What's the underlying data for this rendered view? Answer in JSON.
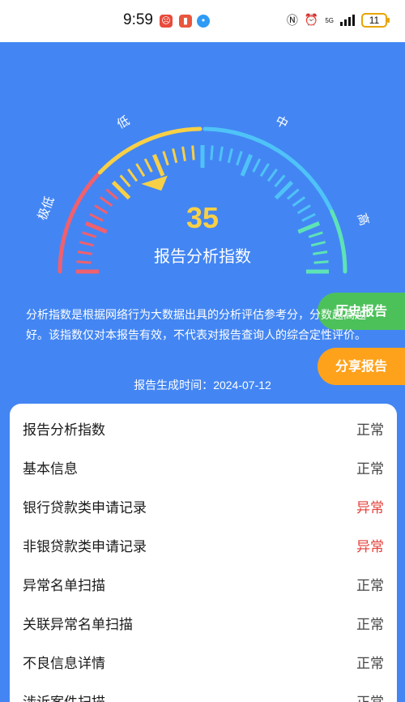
{
  "status_bar": {
    "time": "9:59",
    "network_label": "5G",
    "battery": "11"
  },
  "gauge": {
    "labels": {
      "very_low": "极低",
      "low": "低",
      "mid": "中",
      "high": "高"
    },
    "score": "35",
    "title": "报告分析指数",
    "colors": {
      "red": "#F0606E",
      "yellow": "#F7D046",
      "cyan": "#4FC3F7",
      "green": "#5EE3B5"
    }
  },
  "description": "分析指数是根据网络行为大数据出具的分析评估参考分，分数越高越好。该指数仅对本报告有效，不代表对报告查询人的综合定性评价。",
  "generated": {
    "label": "报告生成时间：",
    "date": "2024-07-12"
  },
  "actions": {
    "history": "历史报告",
    "share": "分享报告"
  },
  "rows": [
    {
      "label": "报告分析指数",
      "status": "正常",
      "abnormal": false
    },
    {
      "label": "基本信息",
      "status": "正常",
      "abnormal": false
    },
    {
      "label": "银行贷款类申请记录",
      "status": "异常",
      "abnormal": true
    },
    {
      "label": "非银贷款类申请记录",
      "status": "异常",
      "abnormal": true
    },
    {
      "label": "异常名单扫描",
      "status": "正常",
      "abnormal": false
    },
    {
      "label": "关联异常名单扫描",
      "status": "正常",
      "abnormal": false
    },
    {
      "label": "不良信息详情",
      "status": "正常",
      "abnormal": false
    },
    {
      "label": "涉诉案件扫描",
      "status": "正常",
      "abnormal": false
    }
  ]
}
